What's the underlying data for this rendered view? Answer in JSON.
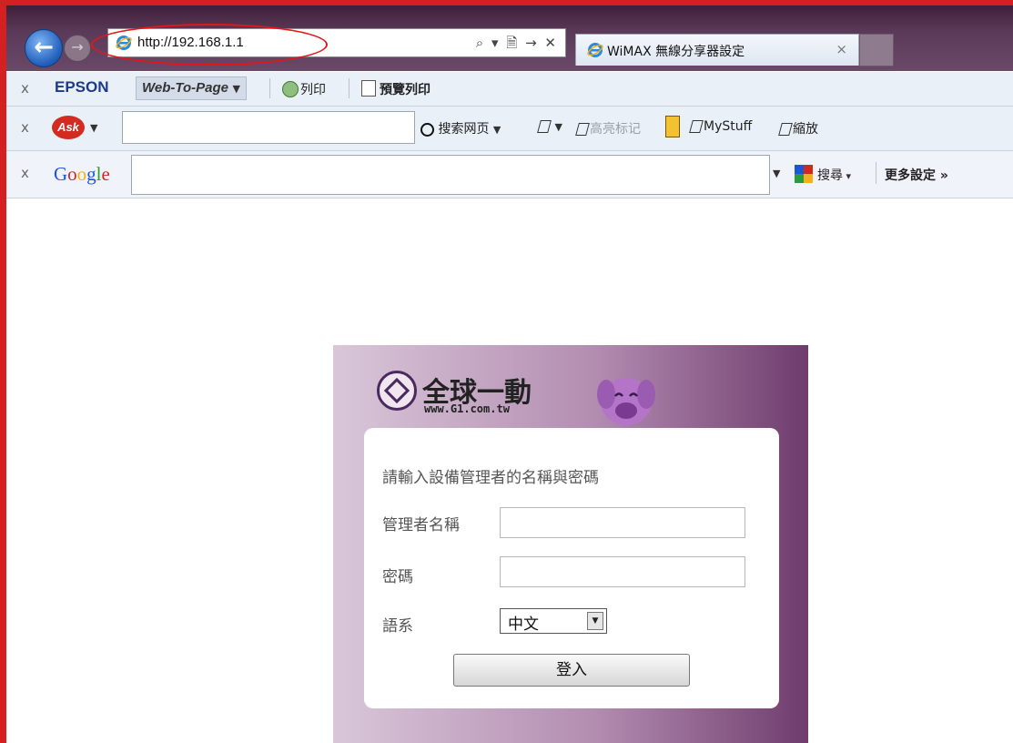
{
  "browser": {
    "url": "http://192.168.1.1",
    "address_controls": "⌕ ▾ 🗎 → ✕",
    "tab_title": "WiMAX 無線分享器設定",
    "tab_close": "×"
  },
  "toolbar_epson": {
    "close": "x",
    "brand": "EPSON",
    "web_to_page": "Web-To-Page",
    "print_label": "列印",
    "preview_print_label": "預覽列印"
  },
  "toolbar_ask": {
    "close": "x",
    "logo_text": "Ask",
    "search_web_label": "搜索网页",
    "highlight_label": "高亮标记",
    "mystuff_label": "MyStuff",
    "zoom_label": "縮放"
  },
  "toolbar_google": {
    "close": "x",
    "search_label": "搜尋",
    "more_settings_label": "更多設定 »"
  },
  "login": {
    "brand_name": "全球一動",
    "brand_url": "www.G1.com.tw",
    "prompt": "請輸入設備管理者的名稱與密碼",
    "username_label": "管理者名稱",
    "username_value": "",
    "password_label": "密碼",
    "password_value": "",
    "language_label": "語系",
    "language_selected": "中文",
    "login_button": "登入"
  },
  "colors": {
    "frame_red": "#d42020",
    "panel_purple": "#6f3c6d",
    "google_blue": "#1a56db"
  }
}
